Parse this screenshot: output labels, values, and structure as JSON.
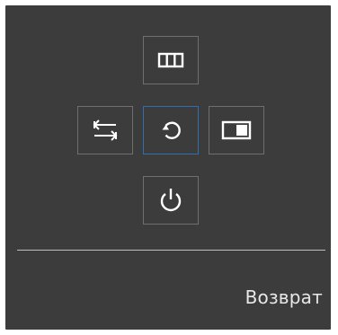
{
  "osd": {
    "buttons": [
      {
        "id": "menu",
        "icon": "menu-icon",
        "selected": false
      },
      {
        "id": "source",
        "icon": "source-icon",
        "selected": false
      },
      {
        "id": "return",
        "icon": "return-icon",
        "selected": true
      },
      {
        "id": "pip",
        "icon": "pip-icon",
        "selected": false
      },
      {
        "id": "power",
        "icon": "power-icon",
        "selected": false
      }
    ],
    "selected_label": "Возврат",
    "colors": {
      "background": "#3c3c3c",
      "button_border": "#6f6f6f",
      "selected_border": "#2f6fb0",
      "icon": "#ffffff",
      "divider": "#bdbdbd",
      "text": "#e8e8e8"
    }
  }
}
